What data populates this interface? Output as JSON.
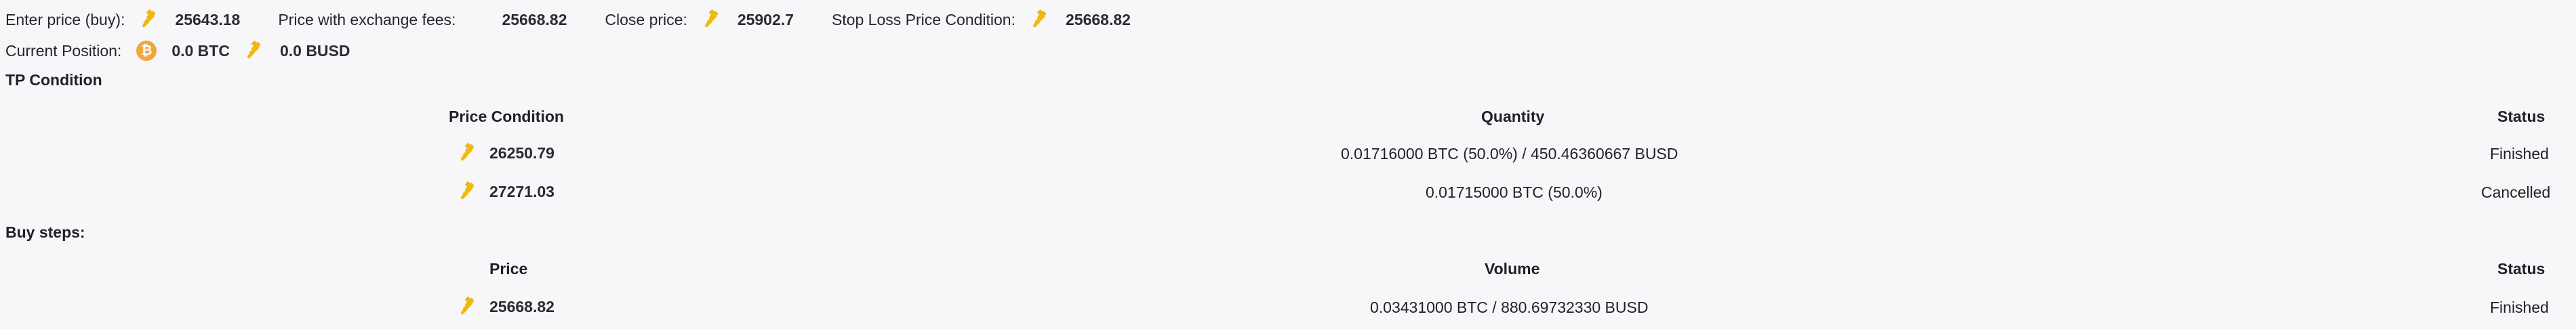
{
  "summary": {
    "enter_price_label": "Enter price (buy):",
    "enter_price_value": "25643.18",
    "exchange_fees_label": "Price with exchange fees:",
    "exchange_fees_value": "25668.82",
    "close_price_label": "Close price:",
    "close_price_value": "25902.7",
    "stop_loss_label": "Stop Loss Price Condition:",
    "stop_loss_value": "25668.82"
  },
  "position": {
    "label": "Current Position:",
    "btc_value": "0.0 BTC",
    "busd_value": "0.0 BUSD"
  },
  "tp_condition": {
    "title": "TP Condition",
    "headers": {
      "price": "Price Condition",
      "quantity": "Quantity",
      "status": "Status"
    },
    "rows": [
      {
        "price": "26250.79",
        "quantity": "0.01716000 BTC (50.0%) / 450.46360667 BUSD",
        "status": "Finished"
      },
      {
        "price": "27271.03",
        "quantity": "0.01715000 BTC (50.0%)",
        "status": "Cancelled"
      }
    ]
  },
  "buy_steps": {
    "title": "Buy steps:",
    "headers": {
      "price": "Price",
      "volume": "Volume",
      "status": "Status"
    },
    "rows": [
      {
        "price": "25668.82",
        "volume": "0.03431000 BTC / 880.69732330 BUSD",
        "status": "Finished"
      }
    ]
  },
  "icons": {
    "busd": "busd-coin-icon",
    "btc": "bitcoin-icon"
  },
  "colors": {
    "busd": "#f0b90b",
    "btc": "#f0a83c",
    "background": "#f7f7f9"
  }
}
